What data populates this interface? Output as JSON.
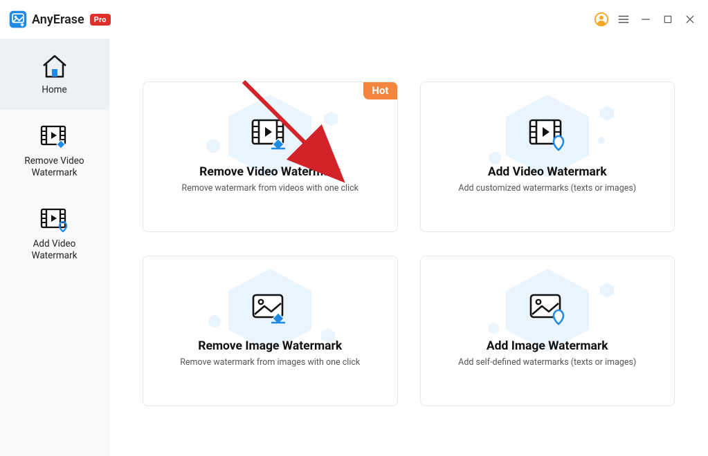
{
  "app": {
    "name": "AnyErase",
    "badge": "Pro"
  },
  "sidebar": {
    "items": [
      {
        "label": "Home"
      },
      {
        "label": "Remove Video\nWatermark"
      },
      {
        "label": "Add Video\nWatermark"
      }
    ]
  },
  "cards": [
    {
      "title": "Remove Video Watermark",
      "desc": "Remove watermark from videos with one click",
      "hot": "Hot"
    },
    {
      "title": "Add Video Watermark",
      "desc": "Add customized watermarks (texts or images)"
    },
    {
      "title": "Remove Image Watermark",
      "desc": "Remove watermark from images with one click"
    },
    {
      "title": "Add Image Watermark",
      "desc": "Add self-defined watermarks  (texts or images)"
    }
  ]
}
